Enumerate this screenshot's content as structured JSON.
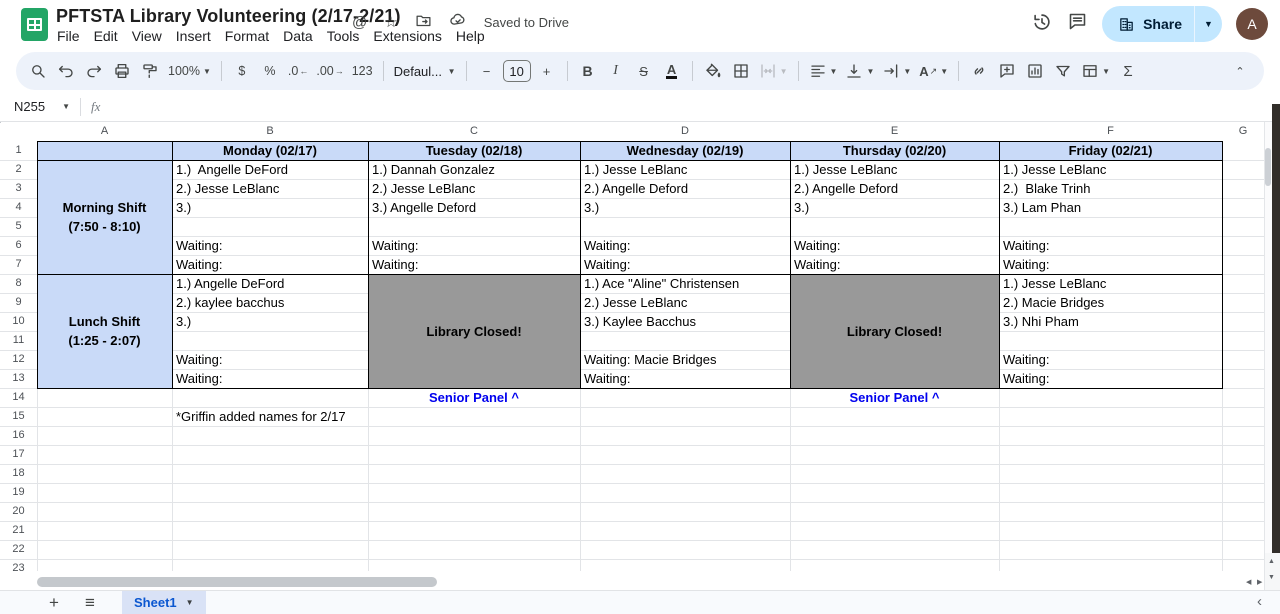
{
  "titlebar": {
    "title": "PFTSTA Library Volunteering (2/17-2/21)",
    "saved_status": "Saved to Drive",
    "share_label": "Share",
    "avatar_letter": "A",
    "menus": [
      "File",
      "Edit",
      "View",
      "Insert",
      "Format",
      "Data",
      "Tools",
      "Extensions",
      "Help"
    ]
  },
  "toolbar": {
    "zoom": "100%",
    "currency": "$",
    "percent": "%",
    "decrease_decimal": ".0",
    "increase_decimal": ".00",
    "number_format": "123",
    "font": "Defaul...",
    "font_size": "10",
    "minus": "−",
    "plus": "+",
    "bold": "B",
    "italic": "I",
    "strikethrough": "S",
    "text_color": "A",
    "functions": "Σ",
    "collapse": "⌃"
  },
  "formula_bar": {
    "cell_reference": "N255",
    "fx_label": "fx"
  },
  "grid": {
    "column_letters": [
      "A",
      "B",
      "C",
      "D",
      "E",
      "F",
      "G"
    ],
    "row_numbers": [
      "1",
      "2",
      "3",
      "4",
      "5",
      "6",
      "7",
      "8",
      "9",
      "10",
      "11",
      "12",
      "13",
      "14",
      "15",
      "16",
      "17",
      "18",
      "19",
      "20",
      "21",
      "22",
      "23"
    ],
    "day_headers": [
      "Monday (02/17)",
      "Tuesday (02/18)",
      "Wednesday (02/19)",
      "Thursday (02/20)",
      "Friday (02/21)"
    ],
    "morning_shift_label": [
      "Morning Shift",
      "(7:50 - 8:10)"
    ],
    "lunch_shift_label": [
      "Lunch Shift",
      "(1:25 - 2:07)"
    ],
    "library_closed": "Library Closed!",
    "senior_panel": "Senior Panel ^",
    "note": "*Griffin added names for 2/17",
    "morning": {
      "monday": [
        "1.)  Angelle DeFord",
        "2.) Jesse LeBlanc",
        "3.)",
        "",
        "Waiting:",
        "Waiting:"
      ],
      "tuesday": [
        "1.) Dannah Gonzalez",
        "2.) Jesse LeBlanc",
        "3.) Angelle Deford",
        "",
        "Waiting:",
        "Waiting:"
      ],
      "wednesday": [
        "1.) Jesse LeBlanc",
        "2.) Angelle Deford",
        "3.)",
        "",
        "Waiting:",
        "Waiting:"
      ],
      "thursday": [
        "1.) Jesse LeBlanc",
        "2.) Angelle Deford",
        "3.)",
        "",
        "Waiting:",
        "Waiting:"
      ],
      "friday": [
        "1.) Jesse LeBlanc",
        "2.)  Blake Trinh",
        "3.) Lam Phan",
        "",
        "Waiting:",
        "Waiting:"
      ]
    },
    "lunch": {
      "monday": [
        "1.) Angelle DeFord",
        "2.) kaylee bacchus",
        "3.)",
        "",
        "Waiting:",
        "Waiting:"
      ],
      "tuesday": "CLOSED",
      "wednesday": [
        "1.) Ace \"Aline\" Christensen",
        "2.) Jesse LeBlanc",
        "3.) Kaylee Bacchus",
        "",
        "Waiting: Macie Bridges",
        "Waiting:"
      ],
      "thursday": "CLOSED",
      "friday": [
        "1.) Jesse LeBlanc",
        "2.) Macie Bridges",
        "3.) Nhi Pham",
        "",
        "Waiting:",
        "Waiting:"
      ]
    }
  },
  "sheetbar": {
    "active_tab": "Sheet1"
  },
  "colors": {
    "header_fill": "#c9daf8",
    "closed_fill": "#999999",
    "senior_panel_text": "#0000ee",
    "table_border": "#000000",
    "share_pill": "#c2e7ff",
    "logo_green": "#23a566",
    "active_tab_text": "#0b57d0"
  }
}
